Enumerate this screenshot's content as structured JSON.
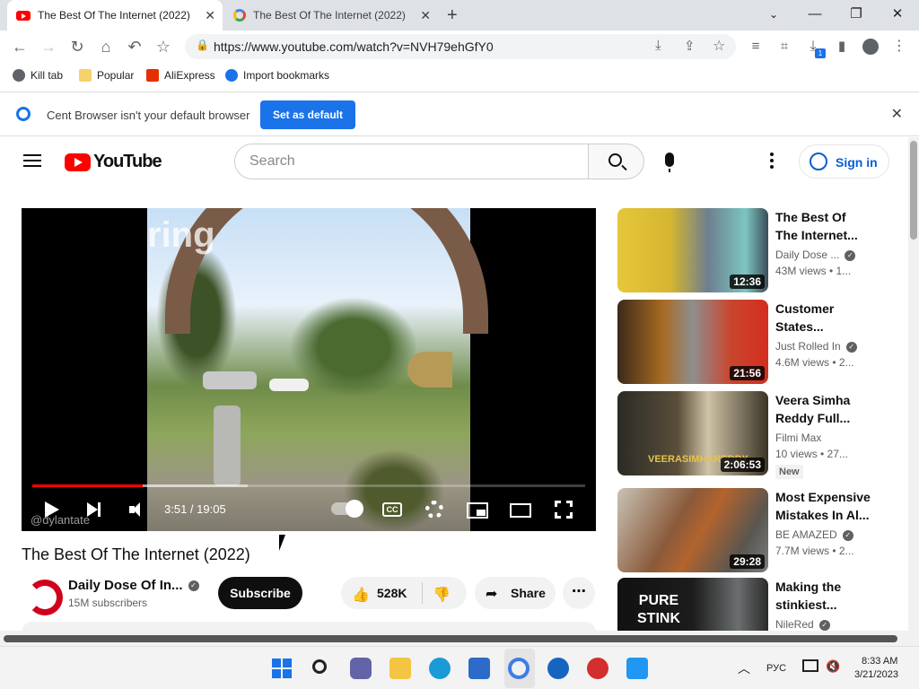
{
  "browser": {
    "tabs": [
      {
        "title": "The Best Of The Internet (2022) -",
        "favicon": "youtube-icon",
        "active": true
      },
      {
        "title": "The Best Of The Internet (2022) -",
        "favicon": "google-icon",
        "active": false
      }
    ],
    "url": "https://www.youtube.com/watch?v=NVH79ehGfY0",
    "download_badge": "1",
    "bookmarks": [
      {
        "label": "Kill tab",
        "icon": "globe-icon"
      },
      {
        "label": "Popular",
        "icon": "folder-icon"
      },
      {
        "label": "AliExpress",
        "icon": "aliexpress-icon"
      },
      {
        "label": "Import bookmarks",
        "icon": "gear-icon"
      }
    ],
    "infobar": {
      "message": "Cent Browser isn't your default browser",
      "button": "Set as default"
    }
  },
  "youtube": {
    "logo_text": "YouTube",
    "search_placeholder": "Search",
    "signin": "Sign in",
    "player": {
      "watermark": "ring",
      "credit": "@dylantate",
      "time": "3:51 / 19:05",
      "progress_played": 0.2,
      "progress_loaded": 0.39
    },
    "video_title": "The Best Of The Internet (2022)",
    "channel": {
      "name": "Daily Dose Of In...",
      "subscribers": "15M subscribers"
    },
    "subscribe": "Subscribe",
    "likes": "528K",
    "share": "Share",
    "related": [
      {
        "title_line1": "The Best Of",
        "title_line2": "The Internet...",
        "channel": "Daily Dose ...",
        "verified": true,
        "meta": "43M views  • 1...",
        "duration": "12:36",
        "badge": ""
      },
      {
        "title_line1": "Customer",
        "title_line2": "States...",
        "channel": "Just Rolled In",
        "verified": true,
        "meta": "4.6M views  • 2...",
        "duration": "21:56",
        "badge": ""
      },
      {
        "title_line1": "Veera Simha",
        "title_line2": "Reddy Full...",
        "channel": "Filmi Max",
        "verified": false,
        "meta": "10 views  • 27...",
        "duration": "2:06:53",
        "badge": "New",
        "thumb_text": "VEERASIMHAREDDY"
      },
      {
        "title_line1": "Most Expensive",
        "title_line2": "Mistakes In Al...",
        "channel": "BE AMAZED",
        "verified": true,
        "meta": "7.7M views  • 2...",
        "duration": "29:28",
        "badge": ""
      },
      {
        "title_line1": "Making the",
        "title_line2": "stinkiest...",
        "channel": "NileRed",
        "verified": true,
        "meta": "",
        "duration": "",
        "badge": "",
        "thumb_text_1": "PURE",
        "thumb_text_2": "STINK"
      }
    ]
  },
  "taskbar": {
    "lang": "РУС",
    "time": "8:33 AM",
    "date": "3/21/2023"
  }
}
